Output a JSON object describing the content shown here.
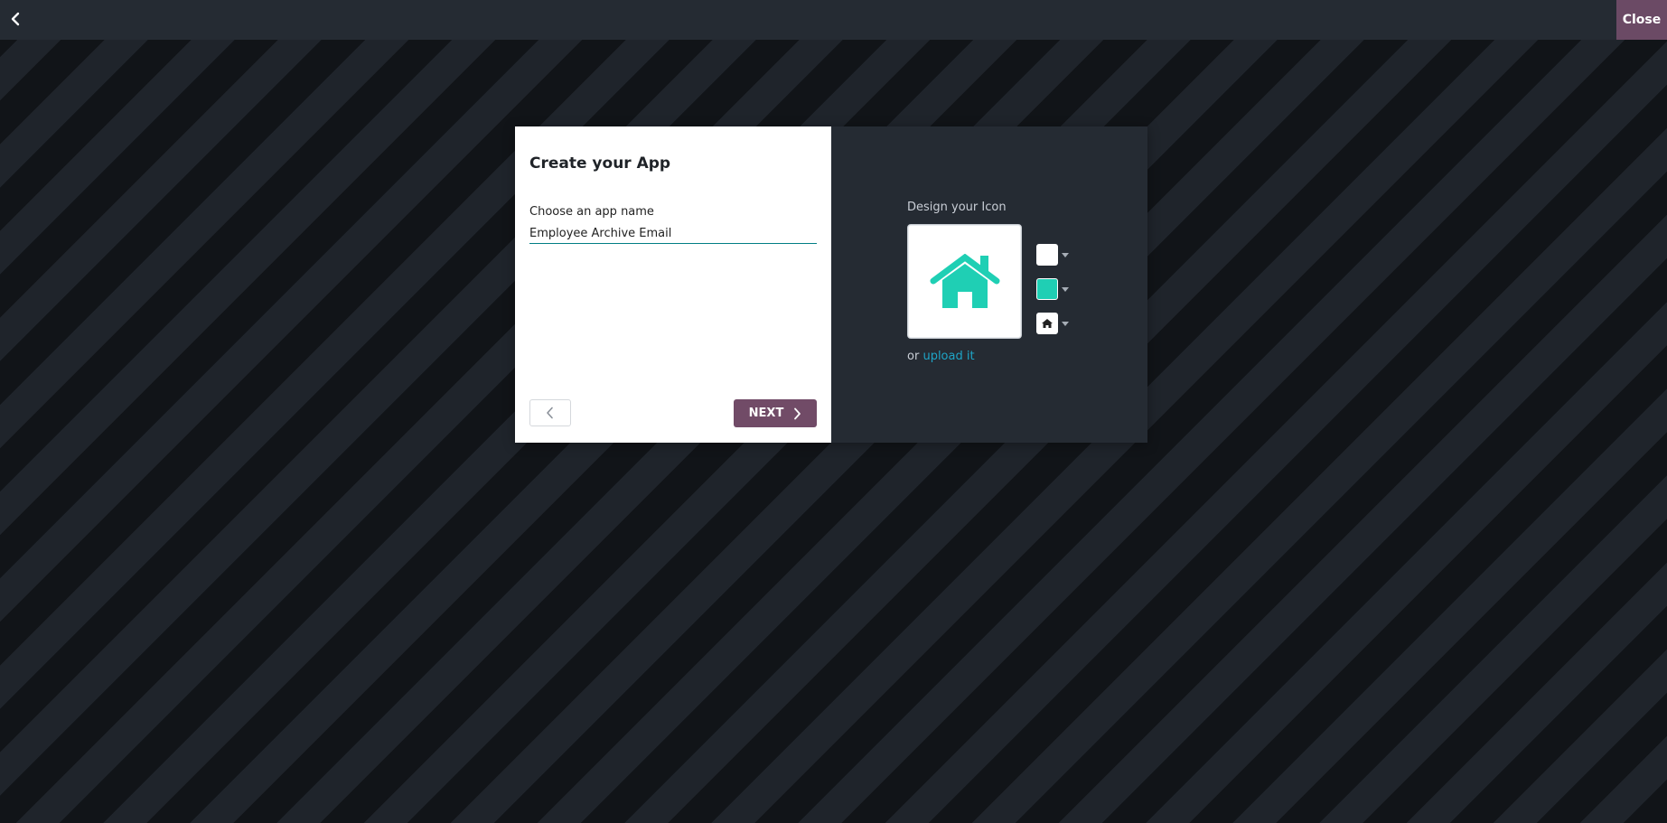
{
  "topbar": {
    "back_icon": "chevron-left-icon",
    "close_label": "Close",
    "close_color": "#6b4a65"
  },
  "dialog": {
    "title": "Create your App",
    "app_name_label": "Choose an app name",
    "app_name_value": "Employee Archive Email",
    "previous_icon": "chevron-left-icon",
    "next_label": "NEXT",
    "next_icon": "chevron-right-icon",
    "next_color": "#714b67"
  },
  "icon_designer": {
    "label": "Design your Icon",
    "preview_icon": "home-icon",
    "background_color": "#ffffff",
    "icon_color": "#1fcfb4",
    "icon_choice": "home-icon",
    "upload_prefix": "or",
    "upload_link": "upload it"
  }
}
